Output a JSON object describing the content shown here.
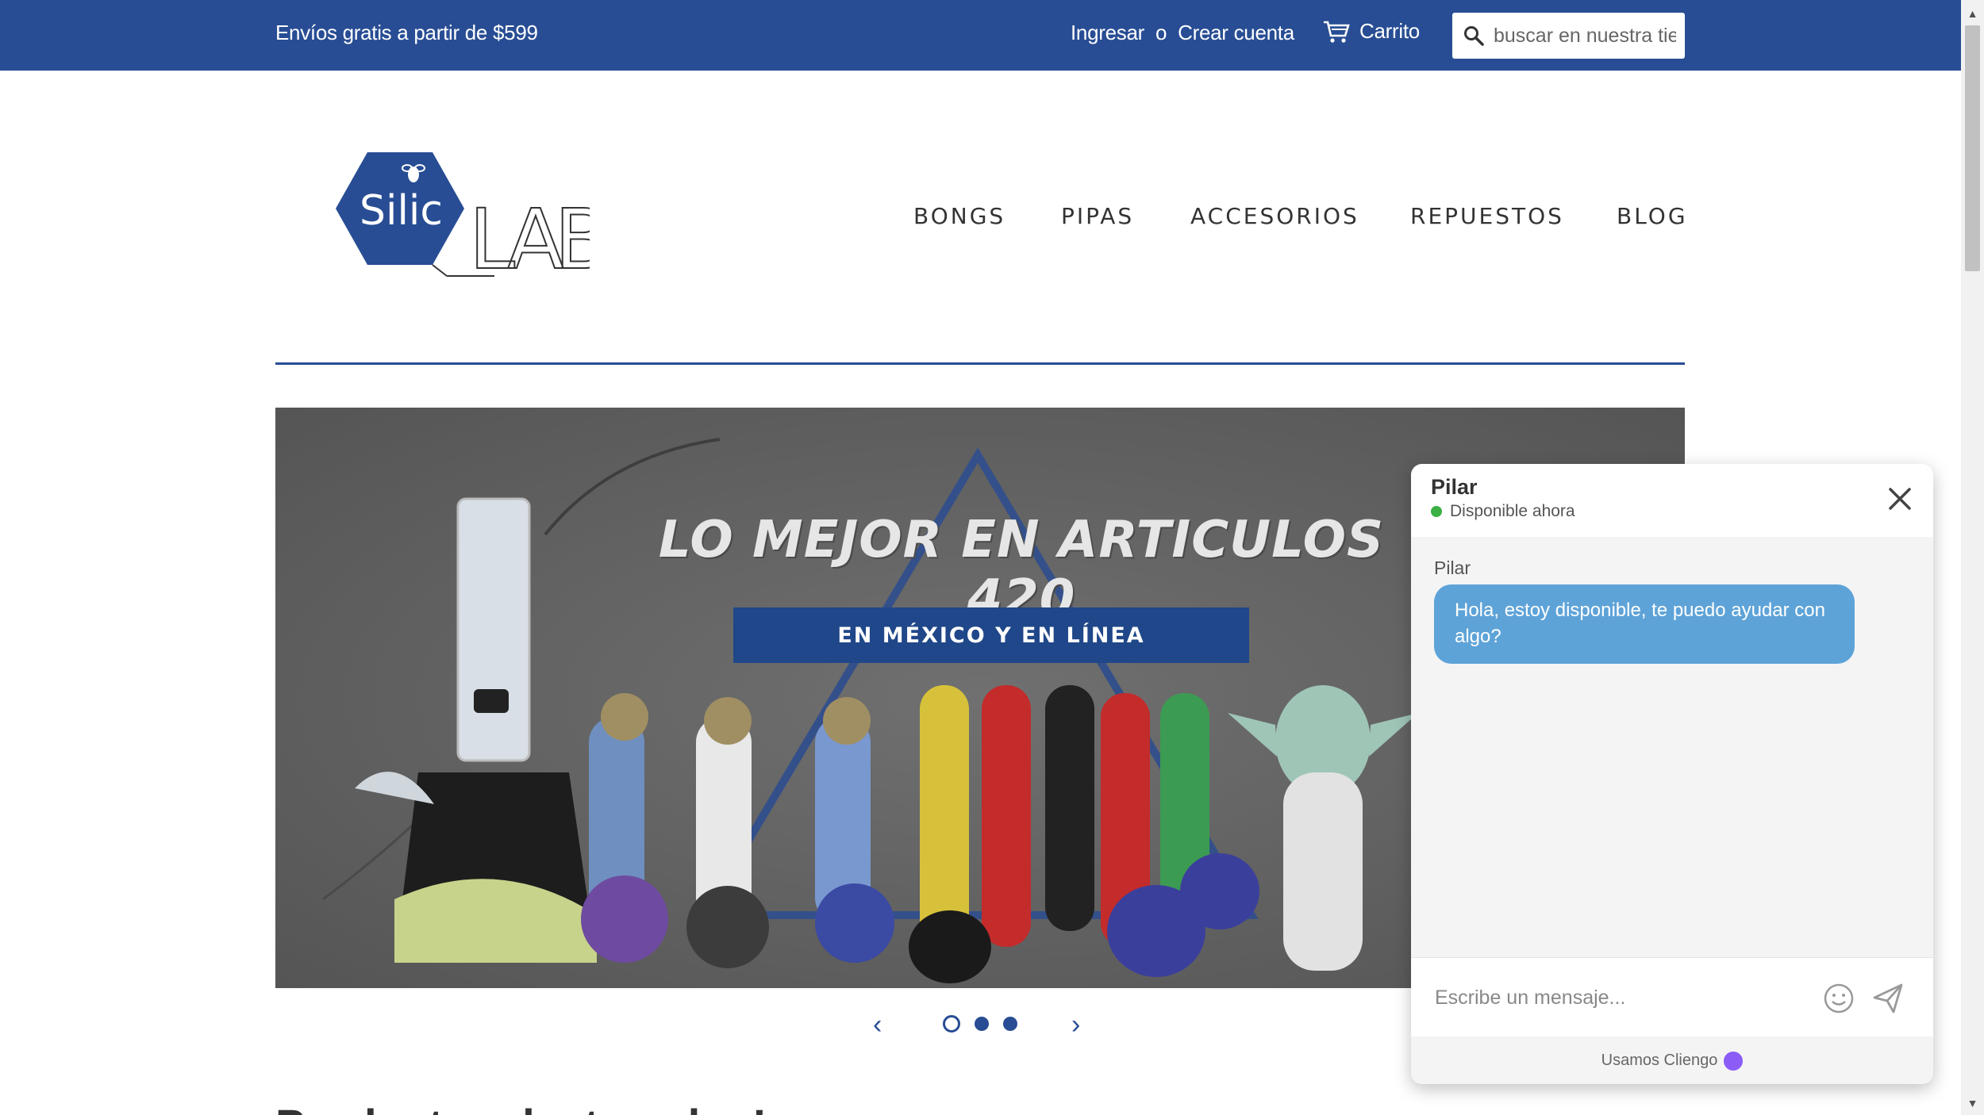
{
  "topbar": {
    "promo": "Envíos gratis a partir de $599",
    "login": "Ingresar",
    "separator": "o",
    "register": "Crear cuenta",
    "cart": "Carrito",
    "search_placeholder": "buscar en nuestra tienda",
    "bg_color": "#284d94"
  },
  "brand": {
    "logo_text_left": "Silic",
    "logo_text_right": "LAB"
  },
  "nav": {
    "items": [
      {
        "label": "BONGS"
      },
      {
        "label": "PIPAS"
      },
      {
        "label": "ACCESORIOS"
      },
      {
        "label": "REPUESTOS"
      },
      {
        "label": "BLOG"
      }
    ]
  },
  "hero": {
    "headline": "LO MEJOR EN ARTICULOS 420",
    "subheadline": "EN MÉXICO Y EN LÍNEA",
    "slides": 3,
    "active_slide": 1
  },
  "slider": {
    "prev": "‹",
    "next": "›"
  },
  "section_peek": "Productos destacados!",
  "chat": {
    "agent": "Pilar",
    "status": "Disponible ahora",
    "messages": [
      {
        "sender": "Pilar",
        "text": "Hola, estoy disponible, te puedo ayudar con algo?"
      }
    ],
    "input_placeholder": "Escribe un mensaje...",
    "footer": "Usamos Cliengo",
    "bubble_color": "#5ea3d8",
    "online_color": "#3cb043"
  }
}
